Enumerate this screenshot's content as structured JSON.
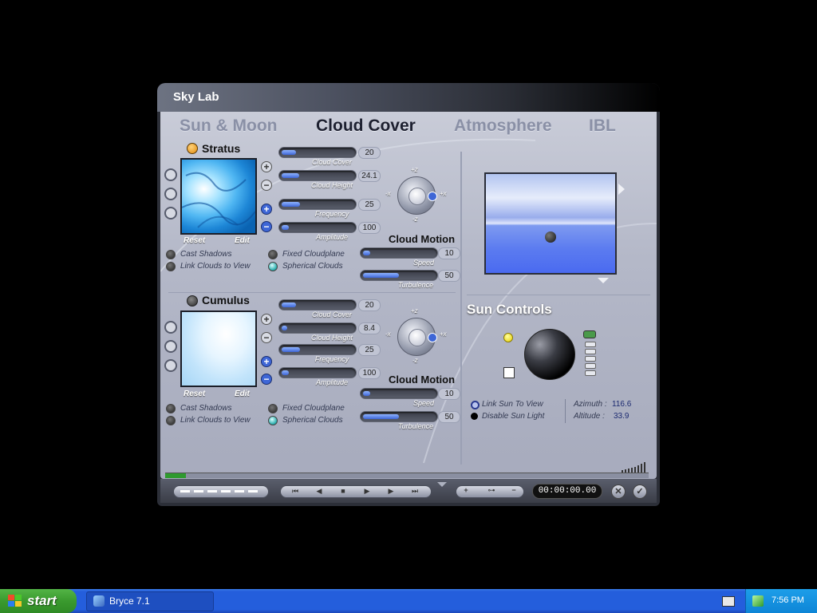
{
  "window": {
    "title": "Sky Lab"
  },
  "tabs": [
    {
      "label": "Sun & Moon",
      "active": false
    },
    {
      "label": "Cloud Cover",
      "active": true
    },
    {
      "label": "Atmosphere",
      "active": false
    },
    {
      "label": "IBL",
      "active": false
    }
  ],
  "stratus": {
    "heading": "Stratus",
    "reset": "Reset",
    "edit": "Edit",
    "sliders": {
      "cloud_cover": {
        "label": "Cloud Cover",
        "value": "20",
        "fraction": 0.2
      },
      "cloud_height": {
        "label": "Cloud Height",
        "value": "24.1",
        "fraction": 0.24
      },
      "frequency": {
        "label": "Frequency",
        "value": "25",
        "fraction": 0.25
      },
      "amplitude": {
        "label": "Amplitude",
        "value": "100",
        "fraction": 0.1
      }
    },
    "options": {
      "cast_shadows": "Cast Shadows",
      "link_clouds": "Link Clouds to View",
      "fixed_cloudplane": "Fixed Cloudplane",
      "spherical_clouds": "Spherical Clouds"
    },
    "motion": {
      "title": "Cloud Motion",
      "speed": {
        "label": "Speed",
        "value": "10",
        "fraction": 0.1
      },
      "turbulence": {
        "label": "Turbulence",
        "value": "50",
        "fraction": 0.5
      }
    },
    "axes": {
      "pz": "+z",
      "nz": "-z",
      "px": "+x",
      "nx": "-x"
    }
  },
  "cumulus": {
    "heading": "Cumulus",
    "reset": "Reset",
    "edit": "Edit",
    "sliders": {
      "cloud_cover": {
        "label": "Cloud Cover",
        "value": "20",
        "fraction": 0.2
      },
      "cloud_height": {
        "label": "Cloud Height",
        "value": "8.4",
        "fraction": 0.08
      },
      "frequency": {
        "label": "Frequency",
        "value": "25",
        "fraction": 0.25
      },
      "amplitude": {
        "label": "Amplitude",
        "value": "100",
        "fraction": 0.1
      }
    },
    "options": {
      "cast_shadows": "Cast Shadows",
      "link_clouds": "Link Clouds to View",
      "fixed_cloudplane": "Fixed Cloudplane",
      "spherical_clouds": "Spherical Clouds"
    },
    "motion": {
      "title": "Cloud Motion",
      "speed": {
        "label": "Speed",
        "value": "10",
        "fraction": 0.1
      },
      "turbulence": {
        "label": "Turbulence",
        "value": "50",
        "fraction": 0.5
      }
    },
    "axes": {
      "pz": "+z",
      "nz": "-z",
      "px": "+x",
      "nx": "-x"
    }
  },
  "sun": {
    "heading": "Sun Controls",
    "link_sun": "Link Sun To View",
    "disable_sun": "Disable Sun Light",
    "azimuth_label": "Azimuth :",
    "azimuth_value": "116.6",
    "altitude_label": "Altitude :",
    "altitude_value": "33.9"
  },
  "timeline": {
    "timecode": "00:00:00.00"
  },
  "taskbar": {
    "start": "start",
    "app": "Bryce 7.1",
    "clock": "7:56 PM"
  },
  "colors": {
    "accent_blue": "#3e66d6",
    "panel": "#b4b8c8",
    "taskbar": "#245edc"
  }
}
